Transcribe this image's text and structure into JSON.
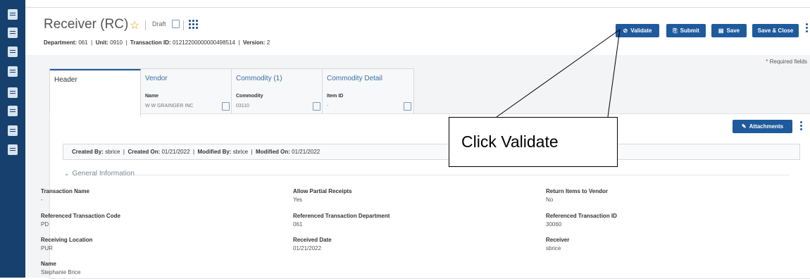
{
  "header": {
    "title": "Receiver (RC)",
    "status": "Draft",
    "meta": {
      "department_label": "Department:",
      "department": "061",
      "unit_label": "Unit:",
      "unit": "0910",
      "transaction_label": "Transaction ID:",
      "transaction_id": "01212200000000498514",
      "version_label": "Version:",
      "version": "2"
    },
    "buttons": {
      "validate": "Validate",
      "submit": "Submit",
      "save": "Save",
      "save_close": "Save & Close"
    }
  },
  "required_note": {
    "star": "*",
    "text": "Required fields"
  },
  "tabs": [
    {
      "label": "Header"
    },
    {
      "label": "Vendor",
      "field_label": "Name",
      "field_value": "W W GRAINGER INC"
    },
    {
      "label": "Commodity (1)",
      "field_label": "Commodity",
      "field_value": "03110"
    },
    {
      "label": "Commodity Detail",
      "field_label": "Item ID",
      "field_value": "-"
    }
  ],
  "attachments_label": "Attachments",
  "audit": {
    "created_by_label": "Created By:",
    "created_by": "sbrice",
    "created_on_label": "Created On:",
    "created_on": "01/21/2022",
    "modified_by_label": "Modified By:",
    "modified_by": "sbrice",
    "modified_on_label": "Modified On:",
    "modified_on": "01/21/2022"
  },
  "section_title": "General Information",
  "fields": [
    {
      "label": "Transaction Name",
      "value": "-"
    },
    {
      "label": "Allow Partial Receipts",
      "value": "Yes"
    },
    {
      "label": "Return Items to Vendor",
      "value": "No"
    },
    {
      "label": "Referenced Transaction Code",
      "value": "PD"
    },
    {
      "label": "Referenced Transaction Department",
      "value": "061"
    },
    {
      "label": "Referenced Transaction ID",
      "value": "30060"
    },
    {
      "label": "Receiving Location",
      "value": "PUR"
    },
    {
      "label": "Received Date",
      "value": "01/21/2022"
    },
    {
      "label": "Receiver",
      "value": "sbrice"
    },
    {
      "label": "Name",
      "value": "Stephanie Brice"
    }
  ],
  "callout_text": "Click Validate",
  "colors": {
    "rail": "#16406d",
    "primary": "#1e5a9c",
    "star": "#d9a300"
  }
}
